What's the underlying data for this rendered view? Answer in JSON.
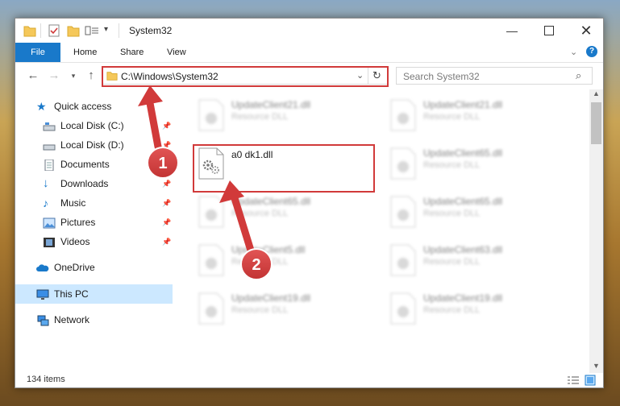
{
  "window": {
    "title": "System32"
  },
  "ribbon": {
    "tabs": [
      "File",
      "Home",
      "Share",
      "View"
    ]
  },
  "address": {
    "path": "C:\\Windows\\System32"
  },
  "search": {
    "placeholder": "Search System32"
  },
  "nav": {
    "items": [
      {
        "label": "Quick access",
        "icon": "star-icon",
        "pinned": false
      },
      {
        "label": "Local Disk (C:)",
        "icon": "drive-icon",
        "pinned": true
      },
      {
        "label": "Local Disk (D:)",
        "icon": "drive-icon",
        "pinned": true
      },
      {
        "label": "Documents",
        "icon": "documents-icon",
        "pinned": true
      },
      {
        "label": "Downloads",
        "icon": "download-arrow-icon",
        "pinned": true
      },
      {
        "label": "Music",
        "icon": "music-note-icon",
        "pinned": true
      },
      {
        "label": "Pictures",
        "icon": "pictures-icon",
        "pinned": true
      },
      {
        "label": "Videos",
        "icon": "videos-icon",
        "pinned": true
      },
      {
        "label": "OneDrive",
        "icon": "cloud-icon",
        "pinned": false
      },
      {
        "label": "This PC",
        "icon": "monitor-icon",
        "pinned": false,
        "selected": true
      },
      {
        "label": "Network",
        "icon": "network-icon",
        "pinned": false
      }
    ]
  },
  "files": {
    "highlighted": {
      "name": "a0 dk1.dll"
    },
    "blurred": [
      {
        "name": "UpdateClient21.dll",
        "type": "Resource DLL"
      },
      {
        "name": "UpdateClient21.dll",
        "type": "Resource DLL"
      },
      {
        "name": "UpdateClient65.dll",
        "type": "Resource DLL"
      },
      {
        "name": "UpdateClient65.dll",
        "type": "Resource DLL"
      },
      {
        "name": "UpdateClient65.dll",
        "type": "Resource DLL"
      },
      {
        "name": "UpdateClient5.dll",
        "type": "Resource DLL"
      },
      {
        "name": "UpdateClient63.dll",
        "type": "Resource DLL"
      },
      {
        "name": "UpdateClient19.dll",
        "type": "Resource DLL"
      },
      {
        "name": "UpdateClient19.dll",
        "type": "Resource DLL"
      }
    ]
  },
  "status": {
    "item_count": "134 items"
  },
  "annotations": {
    "step1": "1",
    "step2": "2"
  },
  "colors": {
    "accent": "#1979ca",
    "annotation": "#d13a3a",
    "selection": "#cce8ff"
  }
}
